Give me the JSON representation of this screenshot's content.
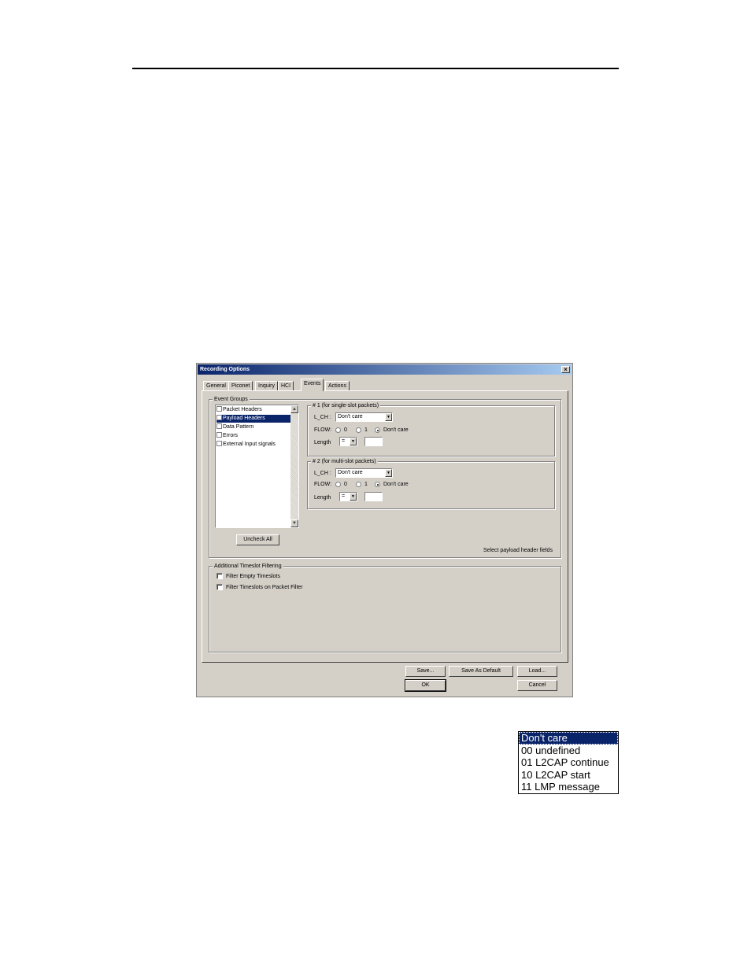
{
  "dialog": {
    "title": "Recording Options",
    "close_glyph": "×",
    "tabs": [
      {
        "label": "General",
        "active": false
      },
      {
        "label": "Piconet",
        "active": false
      },
      {
        "label": "Inquiry",
        "active": false
      },
      {
        "label": "HCI",
        "active": false
      },
      {
        "label": "Events",
        "active": true
      },
      {
        "label": "Actions",
        "active": false
      }
    ],
    "event_groups": {
      "label": "Event Groups",
      "items": [
        {
          "label": "Packet Headers",
          "checked": false,
          "selected": false
        },
        {
          "label": "Payload Headers",
          "checked": false,
          "selected": true
        },
        {
          "label": "Data Pattern",
          "checked": false,
          "selected": false
        },
        {
          "label": "Errors",
          "checked": false,
          "selected": false
        },
        {
          "label": "External Input signals",
          "checked": false,
          "selected": false
        }
      ],
      "uncheck_all_label": "Uncheck All",
      "hint": "Select payload header fields"
    },
    "group1": {
      "label": "# 1 (for single-slot packets)",
      "lch_label": "L_CH :",
      "lch_value": "Don't care",
      "flow_label": "FLOW:",
      "flow_options": [
        "0",
        "1",
        "Don't care"
      ],
      "flow_selected": "Don't care",
      "length_label": "Length",
      "length_op": "=",
      "length_value": ""
    },
    "group2": {
      "label": "# 2 (for multi-slot packets)",
      "lch_label": "L_CH :",
      "lch_value": "Don't care",
      "flow_label": "FLOW:",
      "flow_options": [
        "0",
        "1",
        "Don't care"
      ],
      "flow_selected": "Don't care",
      "length_label": "Length",
      "length_op": "=",
      "length_value": ""
    },
    "timeslot": {
      "label": "Additional Timeslot Filtering",
      "filter_empty": "Filter Empty Timeslots",
      "filter_packet": "Filter Timeslots on Packet Filter"
    },
    "buttons": {
      "save": "Save...",
      "save_default": "Save As Default",
      "load": "Load...",
      "ok": "OK",
      "cancel": "Cancel"
    }
  },
  "lch_dropdown": {
    "options": [
      "Don't care",
      "00 undefined",
      "01 L2CAP continue",
      "10 L2CAP start",
      "11 LMP message"
    ],
    "selected": "Don't care"
  },
  "icons": {
    "dropdown_arrow": "▼",
    "scroll_up": "▲",
    "scroll_down": "▼"
  }
}
